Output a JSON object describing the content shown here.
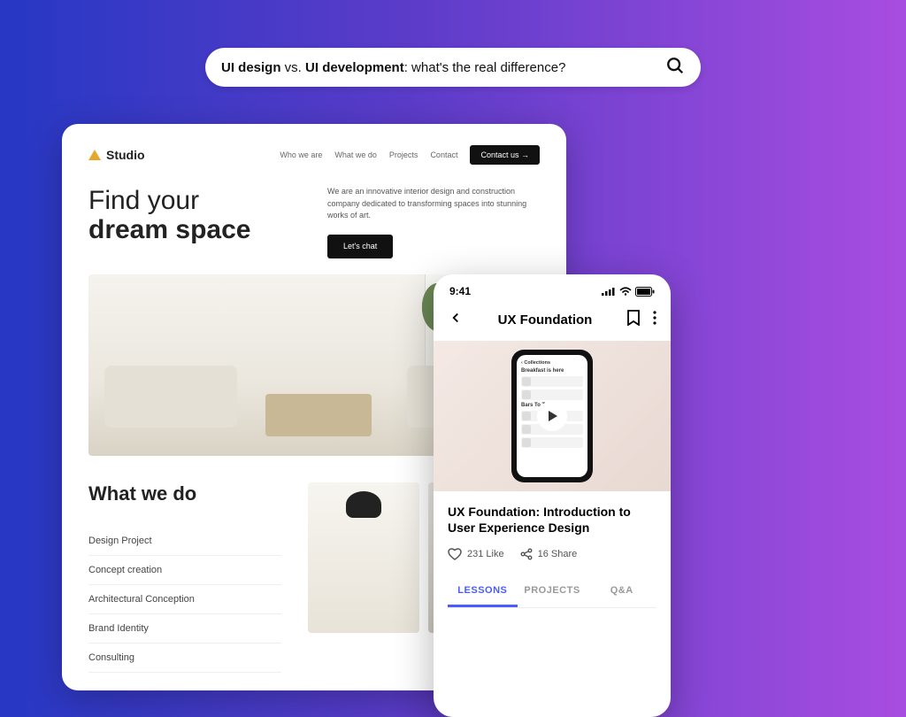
{
  "search": {
    "part1": "UI design",
    "vs": " vs. ",
    "part2": "UI development",
    "tail": ": what's the real difference?"
  },
  "desktop": {
    "brand": "Studio",
    "nav": [
      "Who we are",
      "What we do",
      "Projects",
      "Contact"
    ],
    "contact_btn": "Contact us →",
    "hero_line1": "Find your",
    "hero_line2": "dream space",
    "hero_desc": "We are an innovative interior design and construction company dedicated to transforming spaces into stunning works of art.",
    "hero_btn": "Let's chat",
    "what_title": "What we do",
    "what_items": [
      "Design Project",
      "Concept creation",
      "Architectural Conception",
      "Brand Identity",
      "Consulting"
    ]
  },
  "phone": {
    "time": "9:41",
    "title": "UX Foundation",
    "mini_collections": "‹ Collections",
    "mini_headline": "Breakfast is here",
    "mini_section": "Bars To Try",
    "course_title": "UX Foundation: Introduction to User Experience Design",
    "like_count": "231 Like",
    "share_count": "16 Share",
    "tabs": [
      "LESSONS",
      "PROJECTS",
      "Q&A"
    ]
  }
}
